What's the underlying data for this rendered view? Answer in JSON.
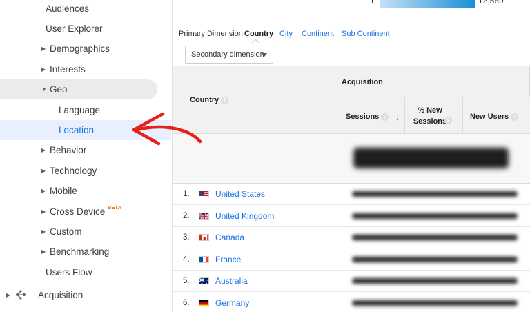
{
  "sidebar": {
    "items": [
      {
        "label": "Audiences"
      },
      {
        "label": "User Explorer"
      },
      {
        "label": "Demographics"
      },
      {
        "label": "Interests"
      },
      {
        "label": "Geo"
      },
      {
        "label": "Language"
      },
      {
        "label": "Location"
      },
      {
        "label": "Behavior"
      },
      {
        "label": "Technology"
      },
      {
        "label": "Mobile"
      },
      {
        "label": "Cross Device",
        "badge": "BETA"
      },
      {
        "label": "Custom"
      },
      {
        "label": "Benchmarking"
      },
      {
        "label": "Users Flow"
      },
      {
        "label": "Acquisition"
      }
    ]
  },
  "map_scale": {
    "min": "1",
    "max": "12,569"
  },
  "dimension": {
    "label": "Primary Dimension:",
    "options": [
      "Country",
      "City",
      "Continent",
      "Sub Continent"
    ]
  },
  "secondary_dimension": {
    "label": "Secondary dimension"
  },
  "table": {
    "country_header": "Country",
    "group_header": "Acquisition",
    "columns": [
      "Sessions",
      "% New Sessions",
      "New Users"
    ],
    "rows": [
      {
        "index": "1.",
        "country": "United States"
      },
      {
        "index": "2.",
        "country": "United Kingdom"
      },
      {
        "index": "3.",
        "country": "Canada"
      },
      {
        "index": "4.",
        "country": "France"
      },
      {
        "index": "5.",
        "country": "Australia"
      },
      {
        "index": "6.",
        "country": "Germany"
      }
    ]
  },
  "help_glyph": "?",
  "sort_glyph": "↓",
  "annotation_color": "#e8201b",
  "link_color": "#1a73e8"
}
